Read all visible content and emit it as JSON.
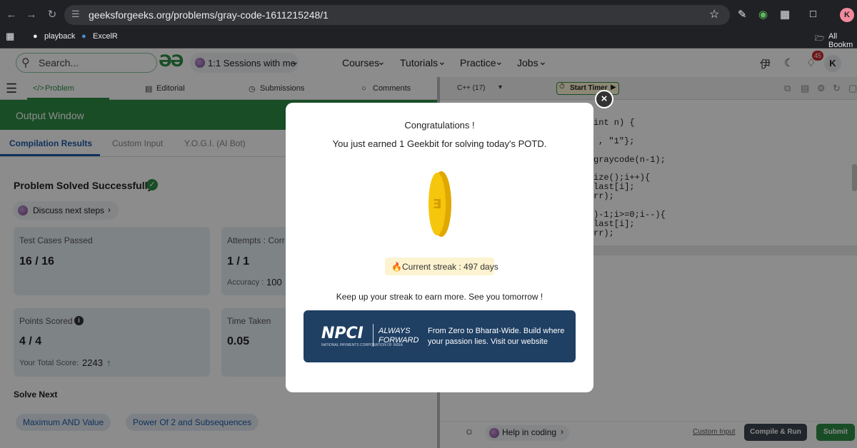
{
  "browser": {
    "url": "geeksforgeeks.org/problems/gray-code-1611215248/1",
    "bookmarks": [
      "playback",
      "ExcelR"
    ],
    "all_bookmarks": "All Bookm",
    "profile_initial": "K"
  },
  "header": {
    "search_placeholder": "Search...",
    "logo": "ƏƏ",
    "sessions_label": "1:1 Sessions with me",
    "nav": [
      "Courses",
      "Tutorials",
      "Practice",
      "Jobs"
    ],
    "notification_count": "45",
    "user_initial": "K"
  },
  "problem_tabs": [
    "Problem",
    "Editorial",
    "Submissions",
    "Comments"
  ],
  "output": {
    "title": "Output Window",
    "subtabs": [
      "Compilation Results",
      "Custom Input",
      "Y.O.G.I. (AI Bot)"
    ],
    "status": "Problem Solved Successfully",
    "discuss": "Discuss next steps",
    "test_cases_label": "Test Cases Passed",
    "test_cases_value": "16 / 16",
    "attempts_label": "Attempts : Corr",
    "attempts_value": "1 / 1",
    "accuracy_label": "Accuracy :",
    "accuracy_value": "100",
    "points_label": "Points Scored",
    "points_value": "4 / 4",
    "total_score_label": "Your Total Score:",
    "total_score_value": "2243",
    "time_label": "Time Taken",
    "time_value": "0.05",
    "solve_next_label": "Solve Next",
    "solve_next": [
      "Maximum AND Value",
      "Power Of 2 and Subsequences"
    ]
  },
  "editor": {
    "language": "C++ (17)",
    "timer_label": "Start Timer",
    "code_lines": [
      "int n) {",
      ", \"1\"};",
      "graycode(n-1);",
      "ize();i++){",
      "last[i];",
      "rr);",
      ")-1;i>=0;i--){",
      "last[i];",
      "rr);"
    ],
    "help_label": "Help in coding",
    "custom_input": "Custom Input",
    "compile_label": "Compile & Run",
    "submit_label": "Submit"
  },
  "modal": {
    "title": "Congratulations !",
    "message": "You just earned 1 Geekbit for solving today's POTD.",
    "streak": "Current streak : 497 days",
    "footer": "Keep up your streak to earn more. See you tomorrow !",
    "banner_logo": "NPCI",
    "banner_logo_sub": "NATIONAL PAYMENTS CORPORATION OF INDIA",
    "banner_tag1": "ALWAYS",
    "banner_tag2": "FORWARD",
    "banner_text": "From Zero to Bharat-Wide. Build where your passion lies. Visit our website"
  }
}
